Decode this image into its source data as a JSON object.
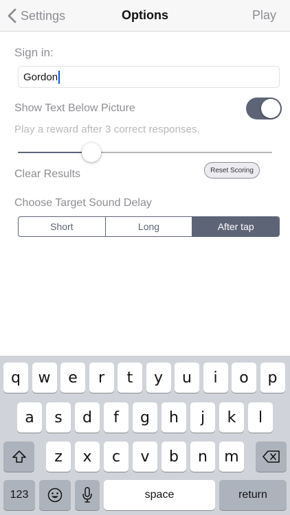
{
  "navbar": {
    "back_label": "Settings",
    "title": "Options",
    "play_label": "Play"
  },
  "form": {
    "signin_label": "Sign in:",
    "signin_value": "Gordon",
    "show_text_label": "Show Text Below Picture",
    "show_text_on": true,
    "reward_label": "Play a reward after 3 correct responses.",
    "reward_slider_fraction": 0.29,
    "clear_label": "Clear Results",
    "reset_button": "Reset Scoring",
    "delay_label": "Choose Target Sound Delay",
    "delay_options": [
      "Short",
      "Long",
      "After tap"
    ],
    "delay_selected": "After tap"
  },
  "colors": {
    "accent": "#5c6476",
    "secondary_text": "#8e8e93",
    "keyboard_bg": "#d0d3d9"
  },
  "keyboard": {
    "row1": [
      "q",
      "w",
      "e",
      "r",
      "t",
      "y",
      "u",
      "i",
      "o",
      "p"
    ],
    "row2": [
      "a",
      "s",
      "d",
      "f",
      "g",
      "h",
      "j",
      "k",
      "l"
    ],
    "row3": [
      "z",
      "x",
      "c",
      "v",
      "b",
      "n",
      "m"
    ],
    "numbers_key": "123",
    "space_key": "space",
    "return_key": "return",
    "icons": {
      "shift": "shift-icon",
      "delete": "delete-icon",
      "emoji": "emoji-icon",
      "mic": "microphone-icon"
    }
  }
}
